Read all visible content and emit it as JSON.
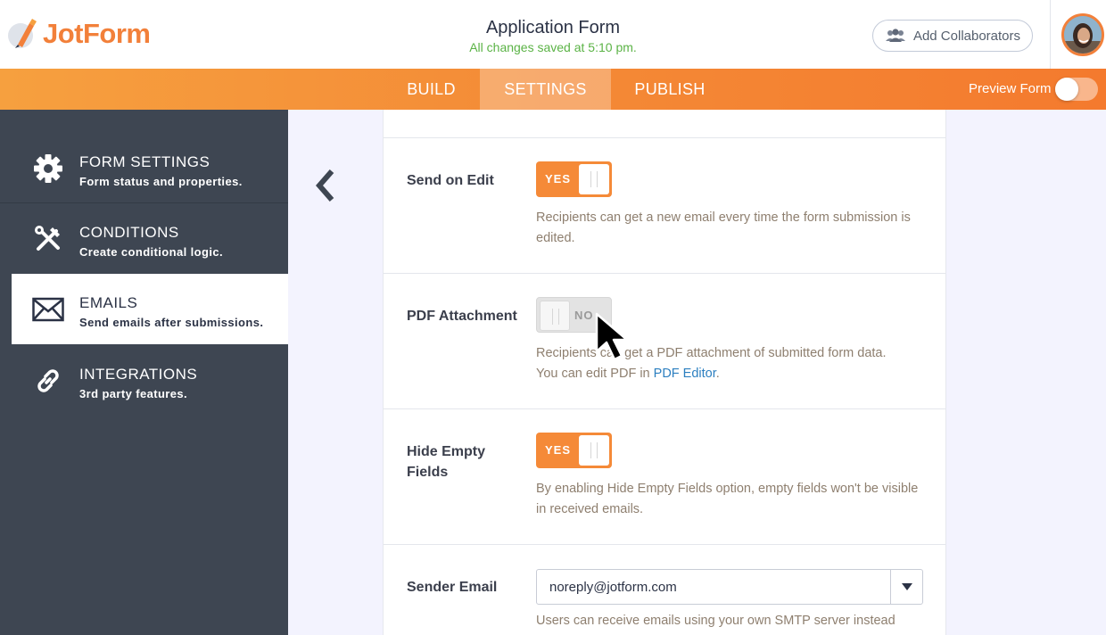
{
  "brand": {
    "name": "JotForm"
  },
  "header": {
    "title": "Application Form",
    "status": "All changes saved at 5:10 pm.",
    "collaborators_label": "Add Collaborators"
  },
  "nav": {
    "tabs": [
      {
        "label": "BUILD",
        "active": false
      },
      {
        "label": "SETTINGS",
        "active": true
      },
      {
        "label": "PUBLISH",
        "active": false
      }
    ],
    "preview_label": "Preview Form",
    "preview_enabled": false
  },
  "sidebar": {
    "items": [
      {
        "title": "FORM SETTINGS",
        "subtitle": "Form status and properties.",
        "icon": "gear-icon",
        "active": false
      },
      {
        "title": "CONDITIONS",
        "subtitle": "Create conditional logic.",
        "icon": "tools-icon",
        "active": false
      },
      {
        "title": "EMAILS",
        "subtitle": "Send emails after submissions.",
        "icon": "envelope-icon",
        "active": true
      },
      {
        "title": "INTEGRATIONS",
        "subtitle": "3rd party features.",
        "icon": "link-icon",
        "active": false
      }
    ]
  },
  "settings": {
    "send_on_edit": {
      "label": "Send on Edit",
      "toggle": "YES",
      "description": "Recipients can get a new email every time the form submission is edited."
    },
    "pdf_attachment": {
      "label": "PDF Attachment",
      "toggle": "NO",
      "description_line1": "Recipients can get a PDF attachment of submitted form data.",
      "description_line2_prefix": "You can edit PDF in ",
      "description_link": "PDF Editor",
      "description_line2_suffix": "."
    },
    "hide_empty_fields": {
      "label": "Hide Empty Fields",
      "toggle": "YES",
      "description": "By enabling Hide Empty Fields option, empty fields won't be visible in received emails."
    },
    "sender_email": {
      "label": "Sender Email",
      "value": "noreply@jotform.com",
      "description": "Users can receive emails using your own SMTP server instead"
    }
  },
  "colors": {
    "accent": "#f58a38",
    "sidebar_bg": "#3e4652",
    "saved_green": "#5bb346",
    "link_blue": "#2c7fc0"
  }
}
